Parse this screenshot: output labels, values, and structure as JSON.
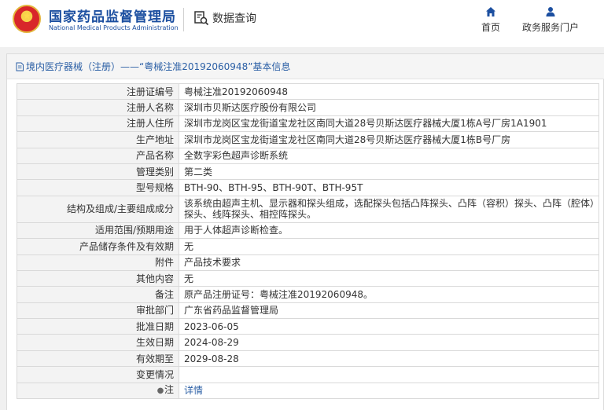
{
  "header": {
    "site_name_cn": "国家药品监督管理局",
    "site_name_en": "National Medical Products Administration",
    "data_query_label": "数据查询",
    "nav": {
      "home": "首页",
      "portal": "政务服务门户"
    }
  },
  "panel": {
    "title": "境内医疗器械（注册）——“粤械注准20192060948”基本信息"
  },
  "rows": [
    {
      "label": "注册证编号",
      "value": "粤械注准20192060948"
    },
    {
      "label": "注册人名称",
      "value": "深圳市贝斯达医疗股份有限公司"
    },
    {
      "label": "注册人住所",
      "value": "深圳市龙岗区宝龙街道宝龙社区南同大道28号贝斯达医疗器械大厦1栋A号厂房1A1901"
    },
    {
      "label": "生产地址",
      "value": "深圳市龙岗区宝龙街道宝龙社区南同大道28号贝斯达医疗器械大厦1栋B号厂房"
    },
    {
      "label": "产品名称",
      "value": "全数字彩色超声诊断系统"
    },
    {
      "label": "管理类别",
      "value": "第二类"
    },
    {
      "label": "型号规格",
      "value": "BTH-90、BTH-95、BTH-90T、BTH-95T"
    },
    {
      "label": "结构及组成/主要组成成分",
      "value": "该系统由超声主机、显示器和探头组成，选配探头包括凸阵探头、凸阵（容积）探头、凸阵（腔体）探头、线阵探头、相控阵探头。"
    },
    {
      "label": "适用范围/预期用途",
      "value": "用于人体超声诊断检查。"
    },
    {
      "label": "产品储存条件及有效期",
      "value": "无"
    },
    {
      "label": "附件",
      "value": "产品技术要求"
    },
    {
      "label": "其他内容",
      "value": "无"
    },
    {
      "label": "备注",
      "value": "原产品注册证号：粤械注准20192060948。"
    },
    {
      "label": "审批部门",
      "value": "广东省药品监督管理局"
    },
    {
      "label": "批准日期",
      "value": "2023-06-05"
    },
    {
      "label": "生效日期",
      "value": "2024-08-29"
    },
    {
      "label": "有效期至",
      "value": "2029-08-28"
    },
    {
      "label": "变更情况",
      "value": ""
    },
    {
      "label": "注",
      "value": "详情"
    }
  ]
}
